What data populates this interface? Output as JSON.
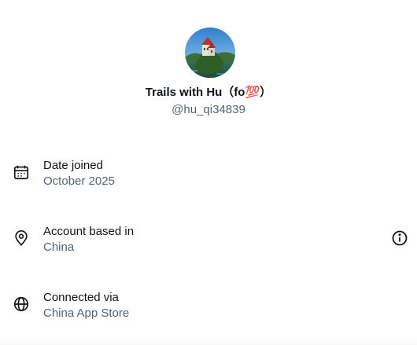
{
  "profile": {
    "display_name": "Trails with Hu（fo",
    "display_name_emoji": "💯",
    "display_name_suffix": "）",
    "handle": "@hu_qi34839"
  },
  "rows": [
    {
      "label": "Date joined",
      "value": "October 2025",
      "icon": "calendar-icon"
    },
    {
      "label": "Account based in",
      "value": "China",
      "icon": "location-pin-icon"
    },
    {
      "label": "Connected via",
      "value": "China App Store",
      "icon": "globe-icon"
    }
  ],
  "colors": {
    "primary_text": "#0f1419",
    "secondary_text": "#536471",
    "emoji_red": "#e0245e"
  }
}
